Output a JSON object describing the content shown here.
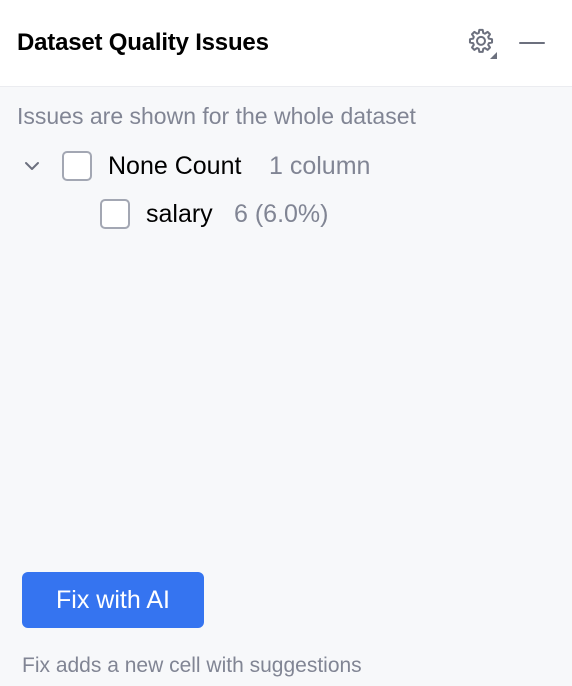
{
  "panel": {
    "title": "Dataset Quality Issues",
    "settings_icon": "gear-icon",
    "minimize_icon": "minimize-icon"
  },
  "scope_note": "Issues are shown for the whole dataset",
  "issues": [
    {
      "label": "None Count",
      "meta": "1 column",
      "expanded": true,
      "checked": false,
      "children": [
        {
          "label": "salary",
          "meta": "6 (6.0%)",
          "checked": false
        }
      ]
    }
  ],
  "actions": {
    "fix_label": "Fix with AI",
    "fix_note": "Fix adds a new cell with suggestions"
  },
  "colors": {
    "accent": "#3574f0",
    "panel_bg": "#f7f8fa",
    "header_bg": "#ffffff",
    "muted_text": "#818594",
    "checkbox_border": "#a3a7b3"
  }
}
